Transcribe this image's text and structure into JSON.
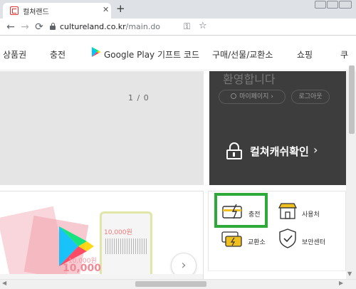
{
  "browser": {
    "tab_title": "컬쳐랜드",
    "tab_close": "✕",
    "new_tab": "+",
    "back": "←",
    "forward": "→",
    "reload": "⟳",
    "url_domain": "cultureland.co.kr",
    "url_path": "/main.do",
    "key_icon": "⚿",
    "star_icon": "☆"
  },
  "nav": {
    "items": [
      "상품권",
      "충전",
      "Google Play 기프트 코드",
      "구매/선물/교환소",
      "쇼핑",
      "쿠"
    ]
  },
  "hero": {
    "counter": "1 / 0"
  },
  "user_panel": {
    "welcome": "환영합니다",
    "mypage": "마이페이지 ›",
    "logout": "로그아웃",
    "cash_check": "컬쳐캐쉬확인",
    "chevron": "›"
  },
  "promo": {
    "card_value": "10,000",
    "card_value_small": "10,000원",
    "card3_label": "10,000원",
    "next": "›"
  },
  "quick_menu": {
    "items": [
      {
        "label": "충전",
        "icon": "charge-card-icon"
      },
      {
        "label": "사용처",
        "icon": "store-icon"
      },
      {
        "label": "교환소",
        "icon": "exchange-icon"
      },
      {
        "label": "보안센터",
        "icon": "shield-check-icon"
      }
    ]
  },
  "colors": {
    "highlight": "#2eaa3a",
    "brand_red": "#e0322f",
    "panel_dark": "#3d3d3d"
  }
}
